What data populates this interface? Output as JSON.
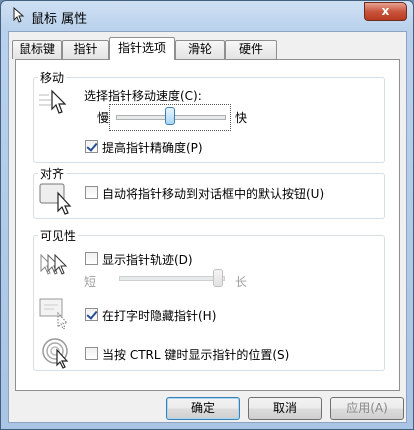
{
  "window": {
    "title": "鼠标 属性",
    "close_glyph": "x"
  },
  "tabs": [
    {
      "label": "鼠标键"
    },
    {
      "label": "指针"
    },
    {
      "label": "指针选项"
    },
    {
      "label": "滑轮"
    },
    {
      "label": "硬件"
    }
  ],
  "active_tab": "指针选项",
  "motion": {
    "title": "移动",
    "speed_label": "选择指针移动速度(C):",
    "slow": "慢",
    "fast": "快",
    "speed_level_fraction": 0.5,
    "precision_label": "提高指针精确度(P)",
    "precision_checked": true
  },
  "snap": {
    "title": "对齐",
    "snap_label": "自动将指针移动到对话框中的默认按钮(U)",
    "snap_checked": false
  },
  "visibility": {
    "title": "可见性",
    "trails_label": "显示指针轨迹(D)",
    "trails_checked": false,
    "short": "短",
    "long": "长",
    "trail_level_fraction": 1.0,
    "hide_label": "在打字时隐藏指针(H)",
    "hide_checked": true,
    "ctrl_label": "当按 CTRL 键时显示指针的位置(S)",
    "ctrl_checked": false
  },
  "buttons": {
    "ok": "确定",
    "cancel": "取消",
    "apply": "应用(A)"
  },
  "colors": {
    "accent": "#3c7fb1",
    "check": "#264f90",
    "frame": "#a9c4e4"
  }
}
